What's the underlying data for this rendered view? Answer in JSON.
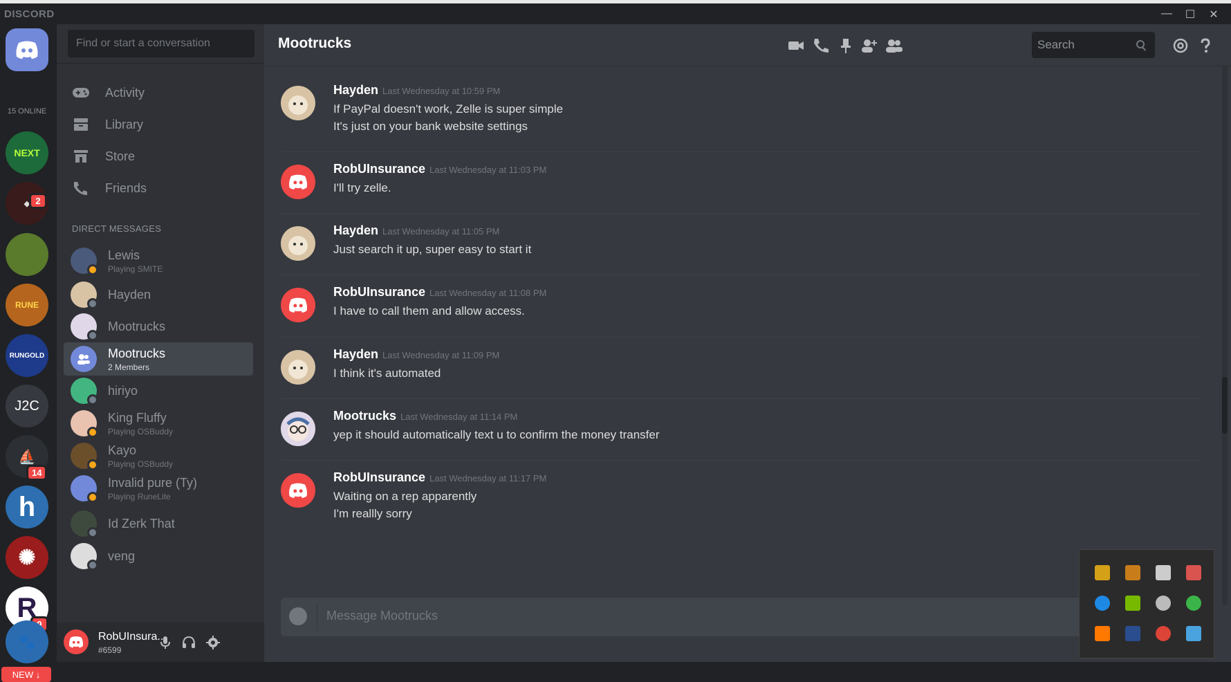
{
  "window": {
    "brand": "DISCORD",
    "controls": [
      "—",
      "☐",
      "✕"
    ]
  },
  "guilds": {
    "online_label": "15 ONLINE",
    "items": [
      {
        "name": "home",
        "label": "",
        "color": "#7289da"
      },
      {
        "name": "next-level",
        "label": "",
        "color": "#1d6b3b"
      },
      {
        "name": "resurgence",
        "label": "",
        "color": "#3a1b1b",
        "badge": "2"
      },
      {
        "name": "landscape",
        "label": "",
        "color": "#5a7a2c"
      },
      {
        "name": "rune-treasure",
        "label": "",
        "color": "#b5651d"
      },
      {
        "name": "rungold",
        "label": "",
        "color": "#1e3a8a"
      },
      {
        "name": "j2c",
        "label": "J2C",
        "color": "#36393f"
      },
      {
        "name": "sailboat",
        "label": "",
        "color": "#2c2f33",
        "badge": "14"
      },
      {
        "name": "h-server",
        "label": "h",
        "color": "#2d6fb0"
      },
      {
        "name": "red-wheel",
        "label": "",
        "color": "#9b1c1c"
      },
      {
        "name": "r-server",
        "label": "R",
        "color": "#ffffff"
      },
      {
        "name": "paw-server",
        "label": "",
        "color": "#2b6cb0",
        "badge": "9"
      }
    ],
    "new_label": "NEW ↓"
  },
  "sidebar": {
    "search_placeholder": "Find or start a conversation",
    "nav": [
      {
        "label": "Activity",
        "icon": "controller-icon"
      },
      {
        "label": "Library",
        "icon": "library-icon"
      },
      {
        "label": "Store",
        "icon": "store-icon"
      },
      {
        "label": "Friends",
        "icon": "friends-icon"
      }
    ],
    "dm_header": "DIRECT MESSAGES",
    "dms": [
      {
        "name": "Lewis",
        "sub": "Playing SMITE",
        "avatar_color": "#4a5a7a",
        "status": "#faa61a"
      },
      {
        "name": "Hayden",
        "sub": "",
        "avatar_color": "#d8c3a5",
        "status": "#747f8d"
      },
      {
        "name": "Mootrucks",
        "sub": "",
        "avatar_color": "#e0d8e8",
        "status": "#747f8d"
      },
      {
        "name": "Mootrucks",
        "sub": "2 Members",
        "avatar_color": "#7289da",
        "status": ""
      },
      {
        "name": "hiriyo",
        "sub": "",
        "avatar_color": "#43b581",
        "status": "#747f8d"
      },
      {
        "name": "King Fluffy",
        "sub": "Playing OSBuddy",
        "avatar_color": "#e9c2b0",
        "status": "#faa61a"
      },
      {
        "name": "Kayo",
        "sub": "Playing OSBuddy",
        "avatar_color": "#6b4f2a",
        "status": "#faa61a"
      },
      {
        "name": "Invalid pure (Ty)",
        "sub": "Playing RuneLite",
        "avatar_color": "#7289da",
        "status": "#faa61a"
      },
      {
        "name": "Id Zerk That",
        "sub": "",
        "avatar_color": "#3e4a3e",
        "status": "#747f8d"
      },
      {
        "name": "veng",
        "sub": "",
        "avatar_color": "#dddddd",
        "status": "#747f8d"
      }
    ]
  },
  "user": {
    "name": "RobUInsura...",
    "tag": "#6599"
  },
  "channel": {
    "name": "Mootrucks",
    "search_placeholder": "Search"
  },
  "messages": [
    {
      "author": "Hayden",
      "time": "Last Wednesday at 10:59 PM",
      "avatar": "hayden",
      "lines": [
        "If PayPal doesn't work, Zelle is super simple",
        "It's just on your bank website settings"
      ]
    },
    {
      "author": "RobUInsurance",
      "time": "Last Wednesday at 11:03 PM",
      "avatar": "discord",
      "lines": [
        "I'll try zelle."
      ]
    },
    {
      "author": "Hayden",
      "time": "Last Wednesday at 11:05 PM",
      "avatar": "hayden",
      "lines": [
        "Just search it up, super easy to start it"
      ]
    },
    {
      "author": "RobUInsurance",
      "time": "Last Wednesday at 11:08 PM",
      "avatar": "discord",
      "lines": [
        "I have to call them and allow access."
      ]
    },
    {
      "author": "Hayden",
      "time": "Last Wednesday at 11:09 PM",
      "avatar": "hayden",
      "lines": [
        "I think it's automated"
      ]
    },
    {
      "author": "Mootrucks",
      "time": "Last Wednesday at 11:14 PM",
      "avatar": "mootrucks",
      "lines": [
        "yep it should automatically text u to confirm the money transfer"
      ]
    },
    {
      "author": "RobUInsurance",
      "time": "Last Wednesday at 11:17 PM",
      "avatar": "discord",
      "lines": [
        "Waiting on a rep apparently",
        "I'm reallly sorry"
      ]
    }
  ],
  "composer": {
    "placeholder": "Message Mootrucks"
  },
  "tray": {
    "icons": [
      {
        "name": "tray-app-1-icon",
        "color": "#d4a017"
      },
      {
        "name": "tray-app-2-icon",
        "color": "#c97d1a"
      },
      {
        "name": "tray-app-3-icon",
        "color": "#cccccc"
      },
      {
        "name": "tray-app-4-icon",
        "color": "#d9534f"
      },
      {
        "name": "bluetooth-icon",
        "color": "#1e88e5"
      },
      {
        "name": "nvidia-icon",
        "color": "#76b900"
      },
      {
        "name": "steam-icon",
        "color": "#bbbbbb"
      },
      {
        "name": "tray-app-5-icon",
        "color": "#3bb54a"
      },
      {
        "name": "avast-icon",
        "color": "#ff7800"
      },
      {
        "name": "tray-app-6-icon",
        "color": "#2a4d8f"
      },
      {
        "name": "chrome-icon",
        "color": "#db4437"
      },
      {
        "name": "tray-app-7-icon",
        "color": "#4aa3df"
      }
    ]
  }
}
